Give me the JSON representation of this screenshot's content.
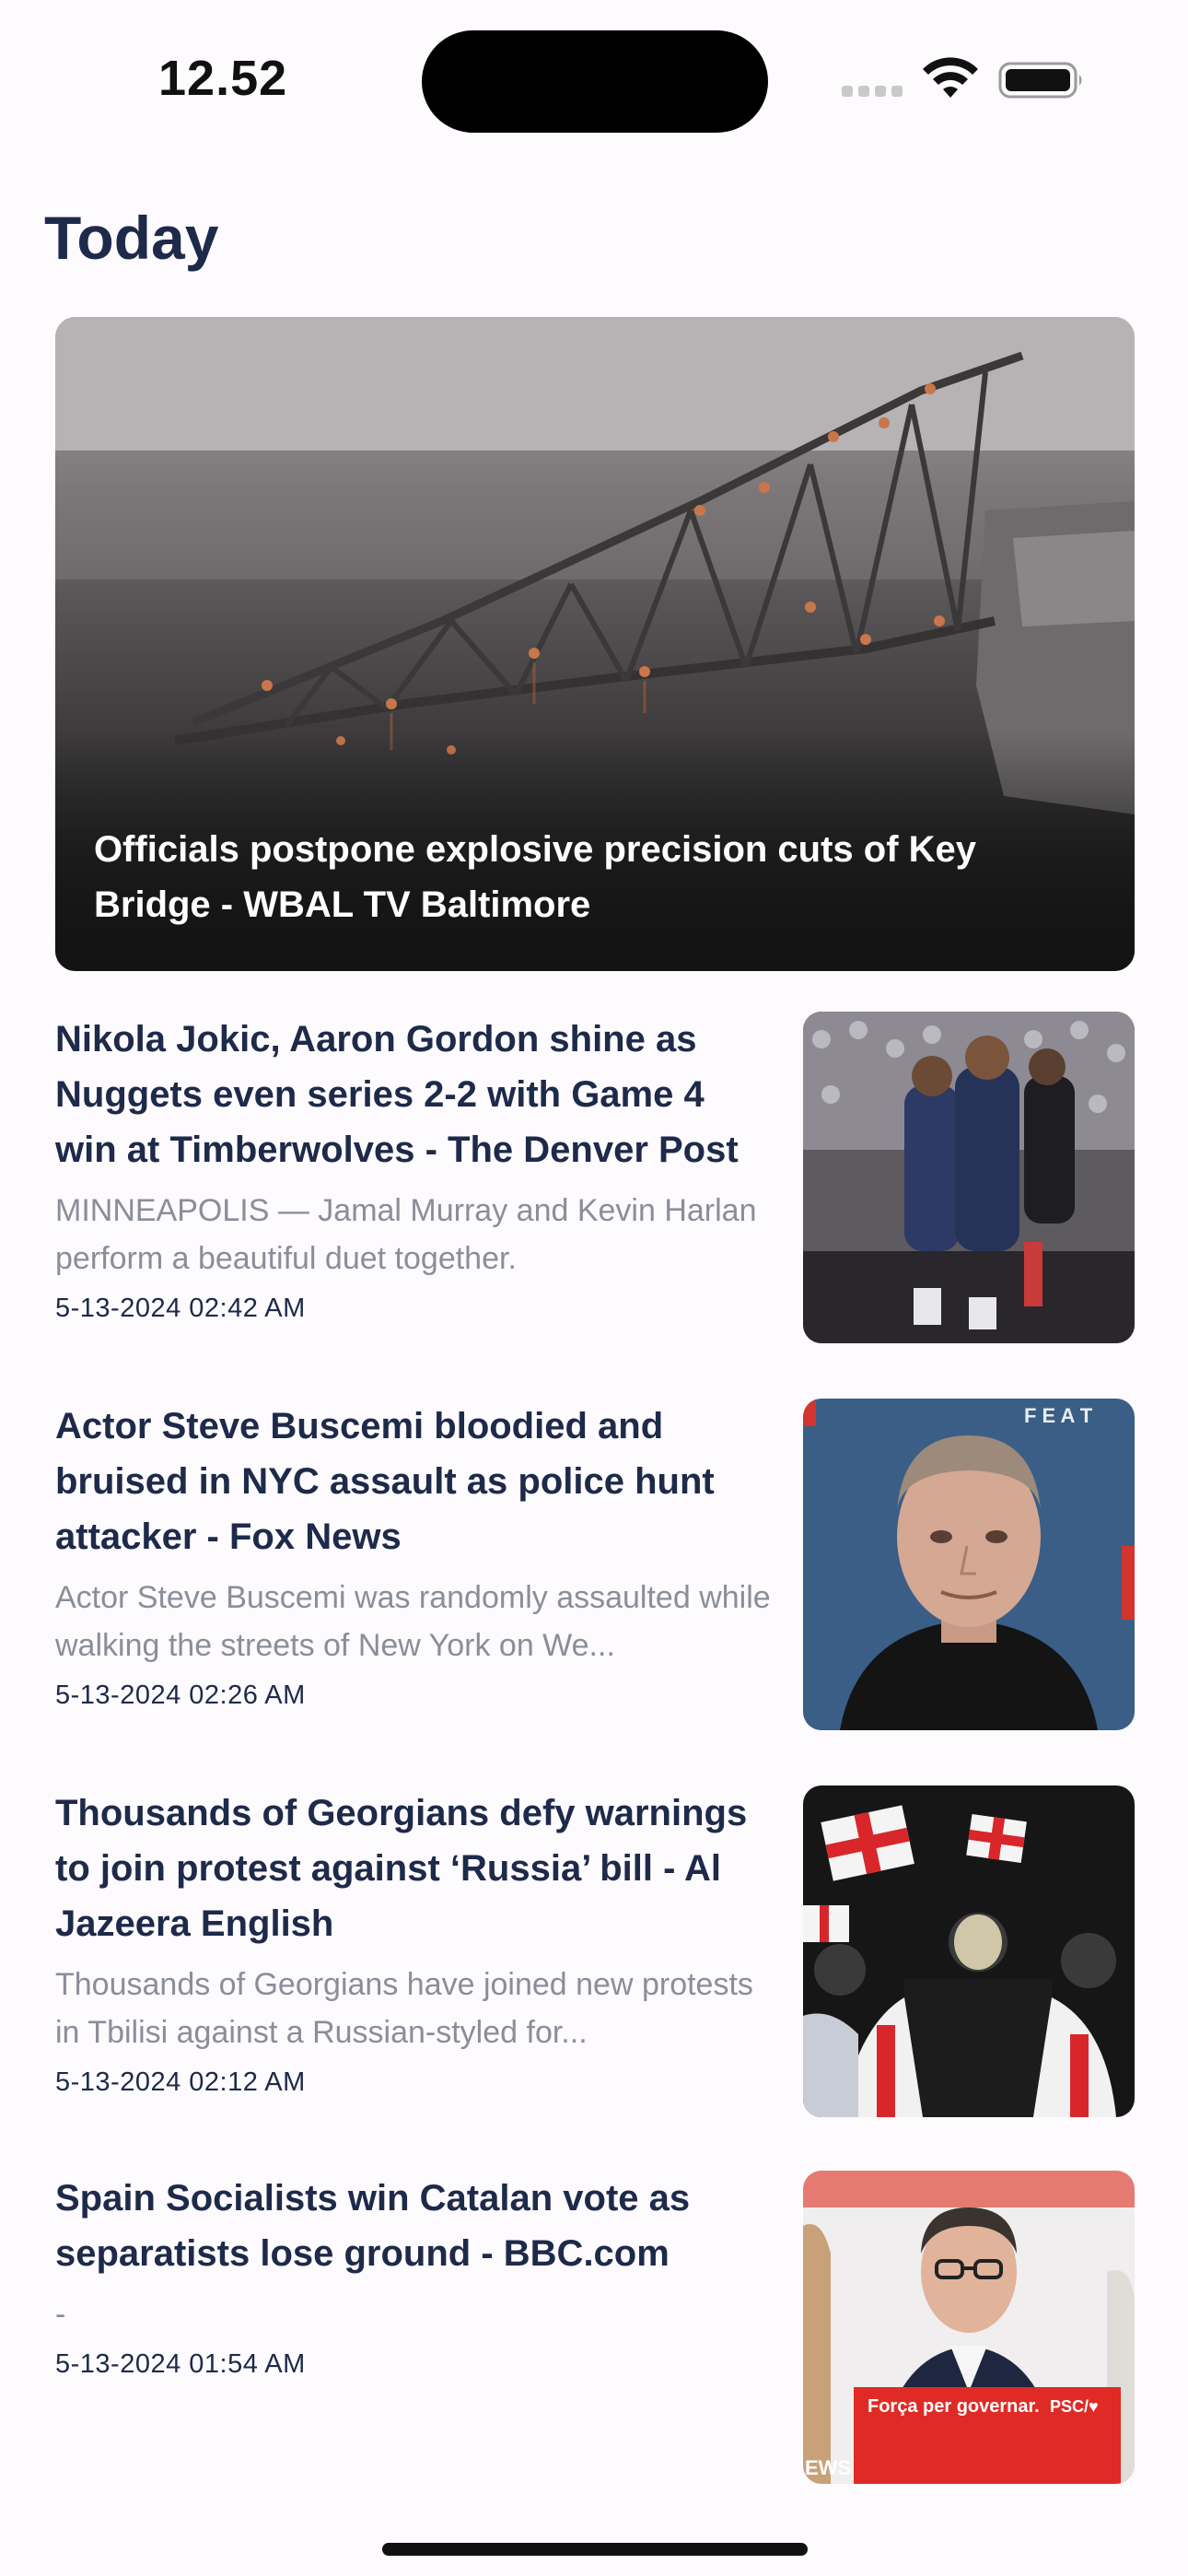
{
  "status_bar": {
    "time": "12.52"
  },
  "header": {
    "title": "Today"
  },
  "hero": {
    "headline": "Officials postpone explosive precision cuts of Key Bridge - WBAL TV Baltimore",
    "image_icon": "collapsed-bridge-photo"
  },
  "articles": [
    {
      "title": "Nikola Jokic, Aaron Gordon shine as Nuggets even series 2-2 with Game 4 win at Timberwolves - The Denver Post",
      "description": "MINNEAPOLIS — Jamal Murray and Kevin Harlan perform a beautiful duet together.",
      "date": "5-13-2024 02:42 AM"
    },
    {
      "title": "Actor Steve Buscemi bloodied and bruised in NYC assault as police hunt attacker - Fox News",
      "description": "Actor Steve Buscemi was randomly assaulted while walking the streets of New York on We...",
      "date": "5-13-2024 02:26 AM",
      "thumb_text": "F E A T"
    },
    {
      "title": "Thousands of Georgians defy warnings to join protest against ‘Russia’ bill - Al Jazeera English",
      "description": "Thousands of Georgians have joined new protests in Tbilisi against a Russian-styled for...",
      "date": "5-13-2024 02:12 AM"
    },
    {
      "title": "Spain Socialists win Catalan vote as separatists lose ground - BBC.com",
      "description": "-",
      "date": "5-13-2024 01:54 AM",
      "thumb_text_banner": "Força per governar.",
      "thumb_text_badge": "PSC/♥",
      "thumb_text_corner": "EWS"
    }
  ],
  "colors": {
    "background": "#fdfbfd",
    "title_text": "#1e2a4a",
    "muted_text": "#8a8e99"
  }
}
